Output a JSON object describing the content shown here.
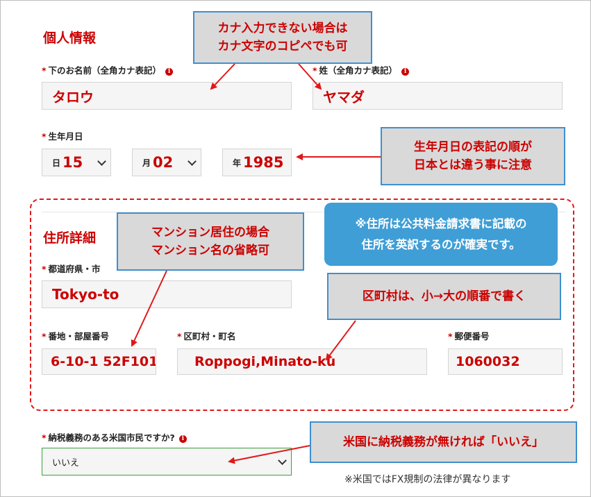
{
  "personal": {
    "section_title": "個人情報",
    "first_name_label": "下のお名前（全角カナ表記）",
    "first_name_value": "タロウ",
    "last_name_label": "姓（全角カナ表記）",
    "last_name_value": "ヤマダ",
    "birthdate_label": "生年月日",
    "day_prefix": "日",
    "day_value": "15",
    "month_prefix": "月",
    "month_value": "02",
    "year_prefix": "年",
    "year_value": "1985"
  },
  "address": {
    "section_title": "住所詳細",
    "prefecture_label": "都道府県・市",
    "prefecture_value": "Tokyo-to",
    "street_label": "番地・部屋番号",
    "street_value": "6-10-1 52F101",
    "city_label": "区町村・町名",
    "city_value": "Roppogi,Minato-ku",
    "postal_label": "郵便番号",
    "postal_value": "1060032"
  },
  "tax": {
    "question_label": "納税義務のある米国市民ですか?",
    "selected_value": "いいえ",
    "footnote": "※米国ではFX規制の法律が異なります"
  },
  "callouts": {
    "kana_line1": "カナ入力できない場合は",
    "kana_line2": "カナ文字のコピペでも可",
    "birth_line1": "生年月日の表記の順が",
    "birth_line2": "日本とは違う事に注意",
    "mansion_line1": "マンション居住の場合",
    "mansion_line2": "マンション名の省略可",
    "address_line1": "※住所は公共料金請求書に記載の",
    "address_line2": "住所を英訳するのが確実です。",
    "order_text": "区町村は、小→大の順番で書く",
    "tax_text": "米国に納税義務が無ければ「いいえ」"
  },
  "colors": {
    "accent_red": "#cc0000",
    "callout_border_blue": "#3f8fcf",
    "callout_bg_gray": "#d9d9d9",
    "info_box_blue": "#3f9ed6",
    "valid_green": "#3aa03a"
  },
  "icons": {
    "info": "info-icon",
    "chevron": "chevron-down-icon",
    "check": "check-icon"
  }
}
